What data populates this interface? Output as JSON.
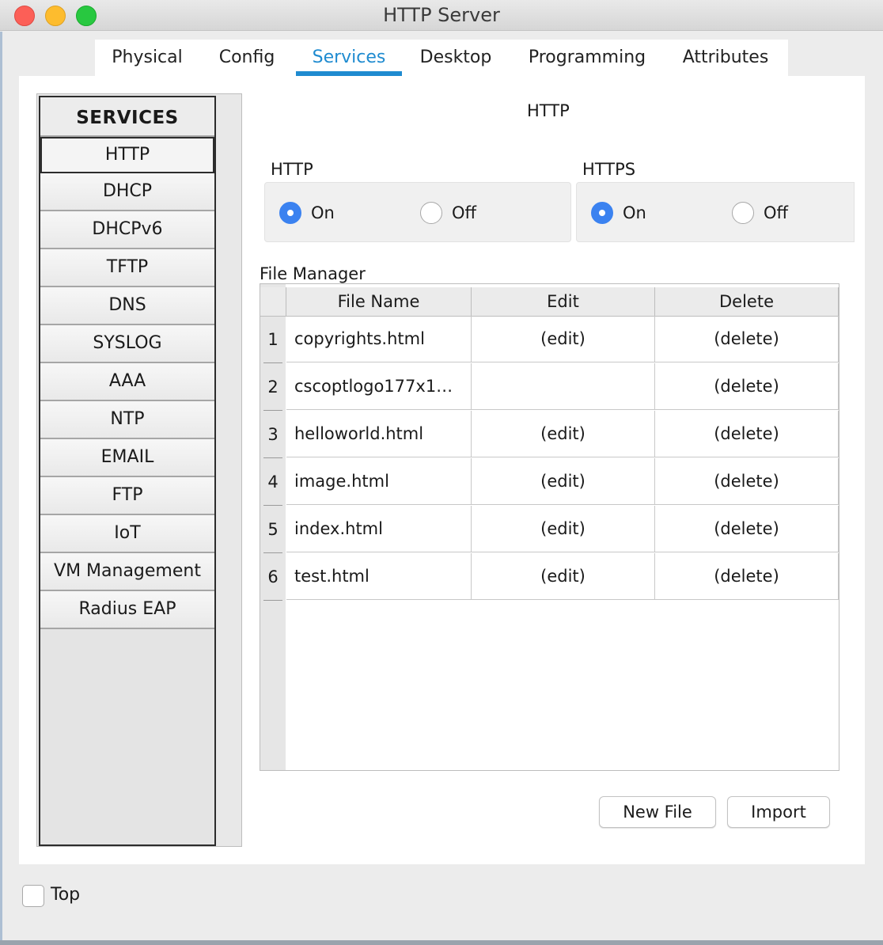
{
  "window": {
    "title": "HTTP Server"
  },
  "tabs": [
    {
      "label": "Physical",
      "active": false
    },
    {
      "label": "Config",
      "active": false
    },
    {
      "label": "Services",
      "active": true
    },
    {
      "label": "Desktop",
      "active": false
    },
    {
      "label": "Programming",
      "active": false
    },
    {
      "label": "Attributes",
      "active": false
    }
  ],
  "sidebar": {
    "header": "SERVICES",
    "items": [
      "HTTP",
      "DHCP",
      "DHCPv6",
      "TFTP",
      "DNS",
      "SYSLOG",
      "AAA",
      "NTP",
      "EMAIL",
      "FTP",
      "IoT",
      "VM Management",
      "Radius EAP"
    ],
    "selected": "HTTP"
  },
  "content": {
    "title": "HTTP",
    "http": {
      "label": "HTTP",
      "on_label": "On",
      "off_label": "Off",
      "value": "On"
    },
    "https": {
      "label": "HTTPS",
      "on_label": "On",
      "off_label": "Off",
      "value": "On"
    },
    "file_manager": {
      "label": "File Manager",
      "columns": [
        "File Name",
        "Edit",
        "Delete"
      ],
      "rows": [
        {
          "num": "1",
          "name": "copyrights.html",
          "edit": "(edit)",
          "delete": "(delete)"
        },
        {
          "num": "2",
          "name": "cscoptlogo177x1…",
          "edit": "",
          "delete": "(delete)"
        },
        {
          "num": "3",
          "name": "helloworld.html",
          "edit": "(edit)",
          "delete": "(delete)"
        },
        {
          "num": "4",
          "name": "image.html",
          "edit": "(edit)",
          "delete": "(delete)"
        },
        {
          "num": "5",
          "name": "index.html",
          "edit": "(edit)",
          "delete": "(delete)"
        },
        {
          "num": "6",
          "name": "test.html",
          "edit": "(edit)",
          "delete": "(delete)"
        }
      ]
    },
    "buttons": {
      "new_file": "New File",
      "import": "Import"
    }
  },
  "footer": {
    "top_label": "Top",
    "top_checked": false
  },
  "colors": {
    "accent": "#1f8bd0",
    "radio_on": "#3b82f0",
    "close": "#fc5f57",
    "minimize": "#fdbc2e",
    "zoom": "#28c840"
  }
}
